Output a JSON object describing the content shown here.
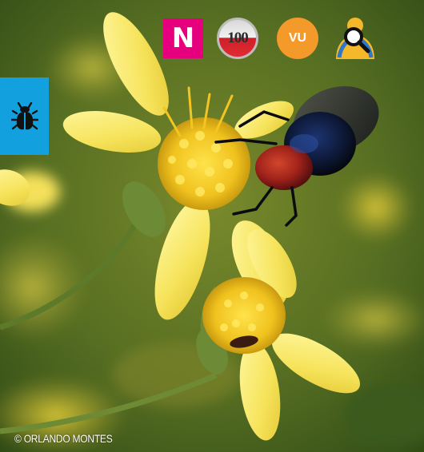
{
  "badges": {
    "native": "N",
    "top100": "100",
    "status": "VU"
  },
  "icons": {
    "native": "native-species-badge",
    "top100": "top-100-badge",
    "status": "vulnerable-status-badge",
    "identify": "magnifier-person-icon",
    "category": "insect-icon"
  },
  "colors": {
    "native_badge": "#e6007e",
    "status_badge": "#f39a2a",
    "category_tab": "#13a0de",
    "identify_icon": "#f5b82a"
  },
  "credit": "© ORLANDO MONTES"
}
